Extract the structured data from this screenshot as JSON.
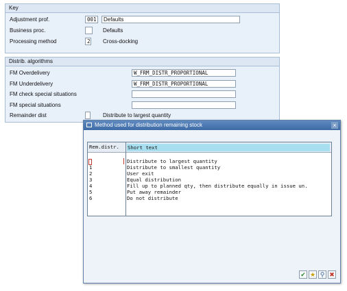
{
  "key_group": {
    "title": "Key",
    "adjustment_prof_label": "Adjustment prof.",
    "adjustment_prof_value": "001",
    "adjustment_prof_desc": "Defaults",
    "business_proc_label": "Business proc.",
    "business_proc_desc": "Defaults",
    "processing_method_label": "Processing method",
    "processing_method_value": "2",
    "processing_method_desc": "Cross-docking"
  },
  "distrib_group": {
    "title": "Distrib. algorithms",
    "fm_overdelivery_label": "FM Overdelivery",
    "fm_overdelivery_value": "W_FRM_DISTR_PROPORTIONAL",
    "fm_underdelivery_label": "FM Underdelivery",
    "fm_underdelivery_value": "W_FRM_DISTR_PROPORTIONAL",
    "fm_check_label": "FM check special situations",
    "fm_special_label": "FM special situations",
    "remainder_label": "Remainder dist",
    "remainder_desc": "Distribute to largest quantity"
  },
  "dialog": {
    "title": "Method used for distribution remaining stock",
    "col_key": "Rem.distr.",
    "col_text": "Short text",
    "rows": [
      {
        "key": "",
        "text": "Distribute to largest quantity"
      },
      {
        "key": "1",
        "text": "Distribute to smallest quantity"
      },
      {
        "key": "2",
        "text": "User exit"
      },
      {
        "key": "3",
        "text": "Equal distribution"
      },
      {
        "key": "4",
        "text": "Fill up to planned qty, then distribute equally in issue un."
      },
      {
        "key": "5",
        "text": "Put away remainder"
      },
      {
        "key": "6",
        "text": "Do not distribute"
      }
    ],
    "buttons": {
      "continue": "✔",
      "find": "★",
      "find_next": "⚲",
      "cancel": "✖"
    }
  }
}
